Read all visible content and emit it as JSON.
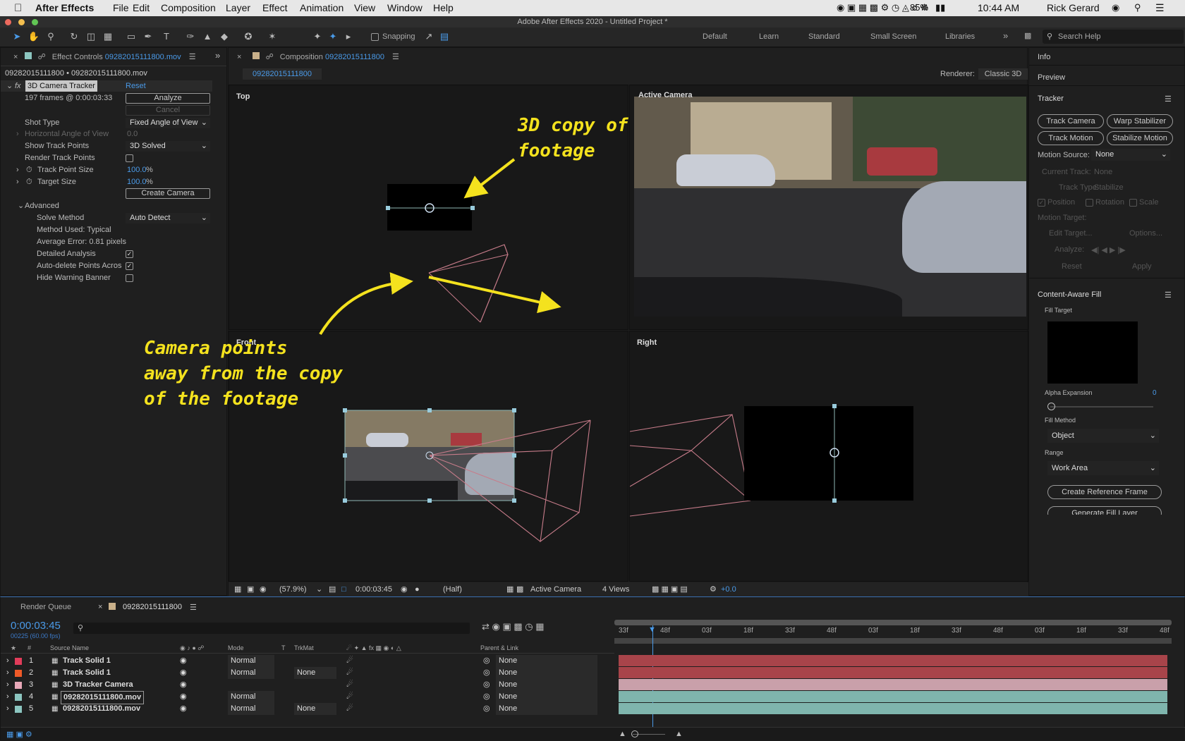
{
  "menubar": {
    "app": "After Effects",
    "items": [
      "File",
      "Edit",
      "Composition",
      "Layer",
      "Effect",
      "Animation",
      "View",
      "Window",
      "Help"
    ],
    "battery": "85%",
    "time": "10:44 AM",
    "user": "Rick Gerard"
  },
  "window_title": "Adobe After Effects 2020 - Untitled Project *",
  "toolbar": {
    "snapping": "Snapping",
    "workspaces": [
      "Default",
      "Learn",
      "Standard",
      "Small Screen",
      "Libraries"
    ],
    "search_placeholder": "Search Help"
  },
  "effect_controls": {
    "tab_label": "Effect Controls",
    "tab_file": "09282015111800.mov",
    "layer_path": "09282015111800 • 09282015111800.mov",
    "effect_name": "3D Camera Tracker",
    "reset": "Reset",
    "frames_info": "197 frames @ 0:00:03:33",
    "analyze": "Analyze",
    "cancel": "Cancel",
    "shot_type_label": "Shot Type",
    "shot_type_value": "Fixed Angle of View",
    "hfov_label": "Horizontal Angle of View",
    "hfov_value": "0.0",
    "show_tp_label": "Show Track Points",
    "show_tp_value": "3D Solved",
    "render_tp_label": "Render Track Points",
    "tp_size_label": "Track Point Size",
    "tp_size_value": "100.0",
    "target_size_label": "Target Size",
    "target_size_value": "100.0",
    "percent": "%",
    "create_camera": "Create Camera",
    "advanced_label": "Advanced",
    "solve_method_label": "Solve Method",
    "solve_method_value": "Auto Detect",
    "method_used": "Method Used: Typical",
    "avg_error": "Average Error: 0.81 pixels",
    "detailed_label": "Detailed Analysis",
    "autodelete_label": "Auto-delete Points Acros",
    "hide_warning_label": "Hide Warning Banner"
  },
  "composition": {
    "tab_label": "Composition",
    "tab_file": "09282015111800",
    "subtab": "09282015111800",
    "renderer_label": "Renderer:",
    "renderer_value": "Classic 3D",
    "view_top": "Top",
    "view_active": "Active Camera",
    "view_front": "Front",
    "view_right": "Right",
    "footer": {
      "zoom": "(57.9%)",
      "timecode": "0:00:03:45",
      "resolution": "(Half)",
      "camera": "Active Camera",
      "views": "4 Views",
      "exposure": "+0.0"
    }
  },
  "annotations": {
    "copy": "3D copy of\nfootage",
    "camera": "Camera points\naway from the copy\nof the footage",
    "color": "#f4e21e"
  },
  "right_panel": {
    "info": "Info",
    "preview": "Preview",
    "tracker": "Tracker",
    "track_camera": "Track Camera",
    "warp_stabilizer": "Warp Stabilizer",
    "track_motion": "Track Motion",
    "stabilize_motion": "Stabilize Motion",
    "motion_source_label": "Motion Source:",
    "motion_source_value": "None",
    "current_track_label": "Current Track:",
    "current_track_value": "None",
    "track_type_label": "Track Type:",
    "track_type_value": "Stabilize",
    "position": "Position",
    "rotation": "Rotation",
    "scale": "Scale",
    "motion_target": "Motion Target:",
    "edit_target": "Edit Target...",
    "options": "Options...",
    "analyze": "Analyze:",
    "reset": "Reset",
    "apply": "Apply",
    "caf_title": "Content-Aware Fill",
    "fill_target": "Fill Target",
    "alpha_expansion": "Alpha Expansion",
    "alpha_value": "0",
    "fill_method_label": "Fill Method",
    "fill_method_value": "Object",
    "range_label": "Range",
    "range_value": "Work Area",
    "create_ref": "Create Reference Frame",
    "generate_fill": "Generate Fill Layer"
  },
  "timeline": {
    "render_queue": "Render Queue",
    "comp_tab": "09282015111800",
    "timecode": "0:00:03:45",
    "frame_info": "00225 (60.00 fps)",
    "col_source": "Source Name",
    "col_mode": "Mode",
    "col_t": "T",
    "col_trkmat": "TrkMat",
    "col_parent": "Parent & Link",
    "ruler": [
      "33f",
      "48f",
      "03f",
      "18f",
      "33f",
      "48f",
      "03f",
      "18f",
      "33f",
      "48f",
      "03f",
      "18f",
      "33f",
      "48f"
    ],
    "layers": [
      {
        "num": "1",
        "name": "Track Solid 1",
        "mode": "Normal",
        "trkmat": "",
        "parent": "None",
        "color": "#c93a3a",
        "label_color": "#e23c5a",
        "bar": "#a8444a"
      },
      {
        "num": "2",
        "name": "Track Solid 1",
        "mode": "Normal",
        "trkmat": "None",
        "parent": "None",
        "color": "#c93a3a",
        "label_color": "#f05a28",
        "bar": "#a8444a"
      },
      {
        "num": "3",
        "name": "3D Tracker Camera",
        "mode": "",
        "trkmat": "",
        "parent": "None",
        "color": "#e8a8b8",
        "label_color": "#e8a8b8",
        "bar": "#c9a0aa"
      },
      {
        "num": "4",
        "name": "09282015111800.mov",
        "mode": "Normal",
        "trkmat": "",
        "parent": "None",
        "color": "#8cc6c0",
        "label_color": "#8cc6c0",
        "bar": "#7fb5ad"
      },
      {
        "num": "5",
        "name": "09282015111800.mov",
        "mode": "Normal",
        "trkmat": "None",
        "parent": "None",
        "color": "#8cc6c0",
        "label_color": "#8cc6c0",
        "bar": "#7fb5ad"
      }
    ]
  }
}
